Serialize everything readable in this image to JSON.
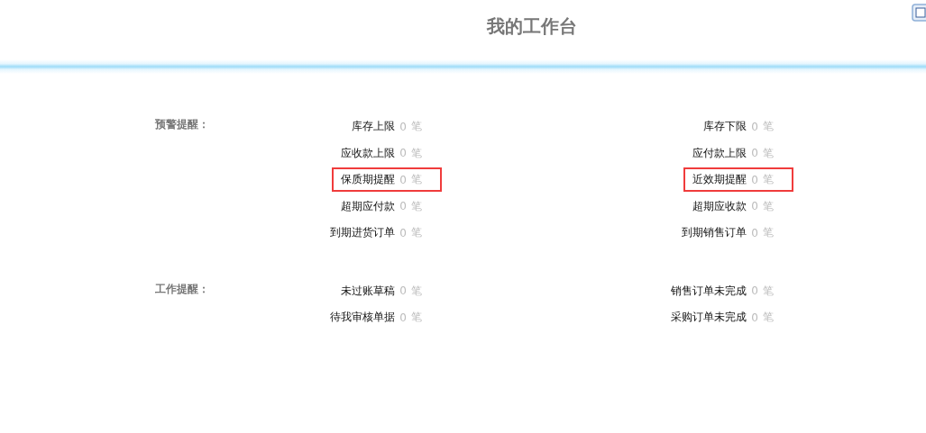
{
  "title": "我的工作台",
  "sections": [
    {
      "label": "预警提醒：",
      "rows": [
        [
          {
            "name": "库存上限",
            "count": "0",
            "unit": "笔",
            "highlighted": false
          },
          {
            "name": "库存下限",
            "count": "0",
            "unit": "笔",
            "highlighted": false
          }
        ],
        [
          {
            "name": "应收款上限",
            "count": "0",
            "unit": "笔",
            "highlighted": false
          },
          {
            "name": "应付款上限",
            "count": "0",
            "unit": "笔",
            "highlighted": false
          }
        ],
        [
          {
            "name": "保质期提醒",
            "count": "0",
            "unit": "笔",
            "highlighted": true
          },
          {
            "name": "近效期提醒",
            "count": "0",
            "unit": "笔",
            "highlighted": true
          }
        ],
        [
          {
            "name": "超期应付款",
            "count": "0",
            "unit": "笔",
            "highlighted": false
          },
          {
            "name": "超期应收款",
            "count": "0",
            "unit": "笔",
            "highlighted": false
          }
        ],
        [
          {
            "name": "到期进货订单",
            "count": "0",
            "unit": "笔",
            "highlighted": false
          },
          {
            "name": "到期销售订单",
            "count": "0",
            "unit": "笔",
            "highlighted": false
          }
        ]
      ]
    },
    {
      "label": "工作提醒：",
      "rows": [
        [
          {
            "name": "未过账草稿",
            "count": "0",
            "unit": "笔",
            "highlighted": false
          },
          {
            "name": "销售订单未完成",
            "count": "0",
            "unit": "笔",
            "highlighted": false
          }
        ],
        [
          {
            "name": "待我审核单据",
            "count": "0",
            "unit": "笔",
            "highlighted": false
          },
          {
            "name": "采购订单未完成",
            "count": "0",
            "unit": "笔",
            "highlighted": false
          }
        ]
      ]
    }
  ]
}
